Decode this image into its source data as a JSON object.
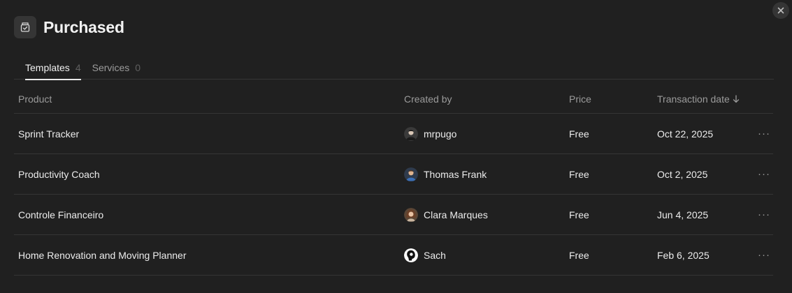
{
  "header": {
    "title": "Purchased",
    "icon": "shopping-bag-check-icon"
  },
  "tabs": [
    {
      "label": "Templates",
      "count": "4",
      "active": true
    },
    {
      "label": "Services",
      "count": "0",
      "active": false
    }
  ],
  "table": {
    "columns": {
      "product": "Product",
      "created_by": "Created by",
      "price": "Price",
      "date": "Transaction date"
    },
    "sort": "descending",
    "rows": [
      {
        "product": "Sprint Tracker",
        "creator": "mrpugo",
        "price": "Free",
        "date": "Oct 22, 2025"
      },
      {
        "product": "Productivity Coach",
        "creator": "Thomas Frank",
        "price": "Free",
        "date": "Oct 2, 2025"
      },
      {
        "product": "Controle Financeiro",
        "creator": "Clara Marques",
        "price": "Free",
        "date": "Jun 4, 2025"
      },
      {
        "product": "Home Renovation and Moving Planner",
        "creator": "Sach",
        "price": "Free",
        "date": "Feb 6, 2025"
      }
    ]
  },
  "more_label": "···",
  "colors": {
    "background": "#202020",
    "border": "#353535",
    "text": "#ececec",
    "muted": "#9b9b9b"
  }
}
